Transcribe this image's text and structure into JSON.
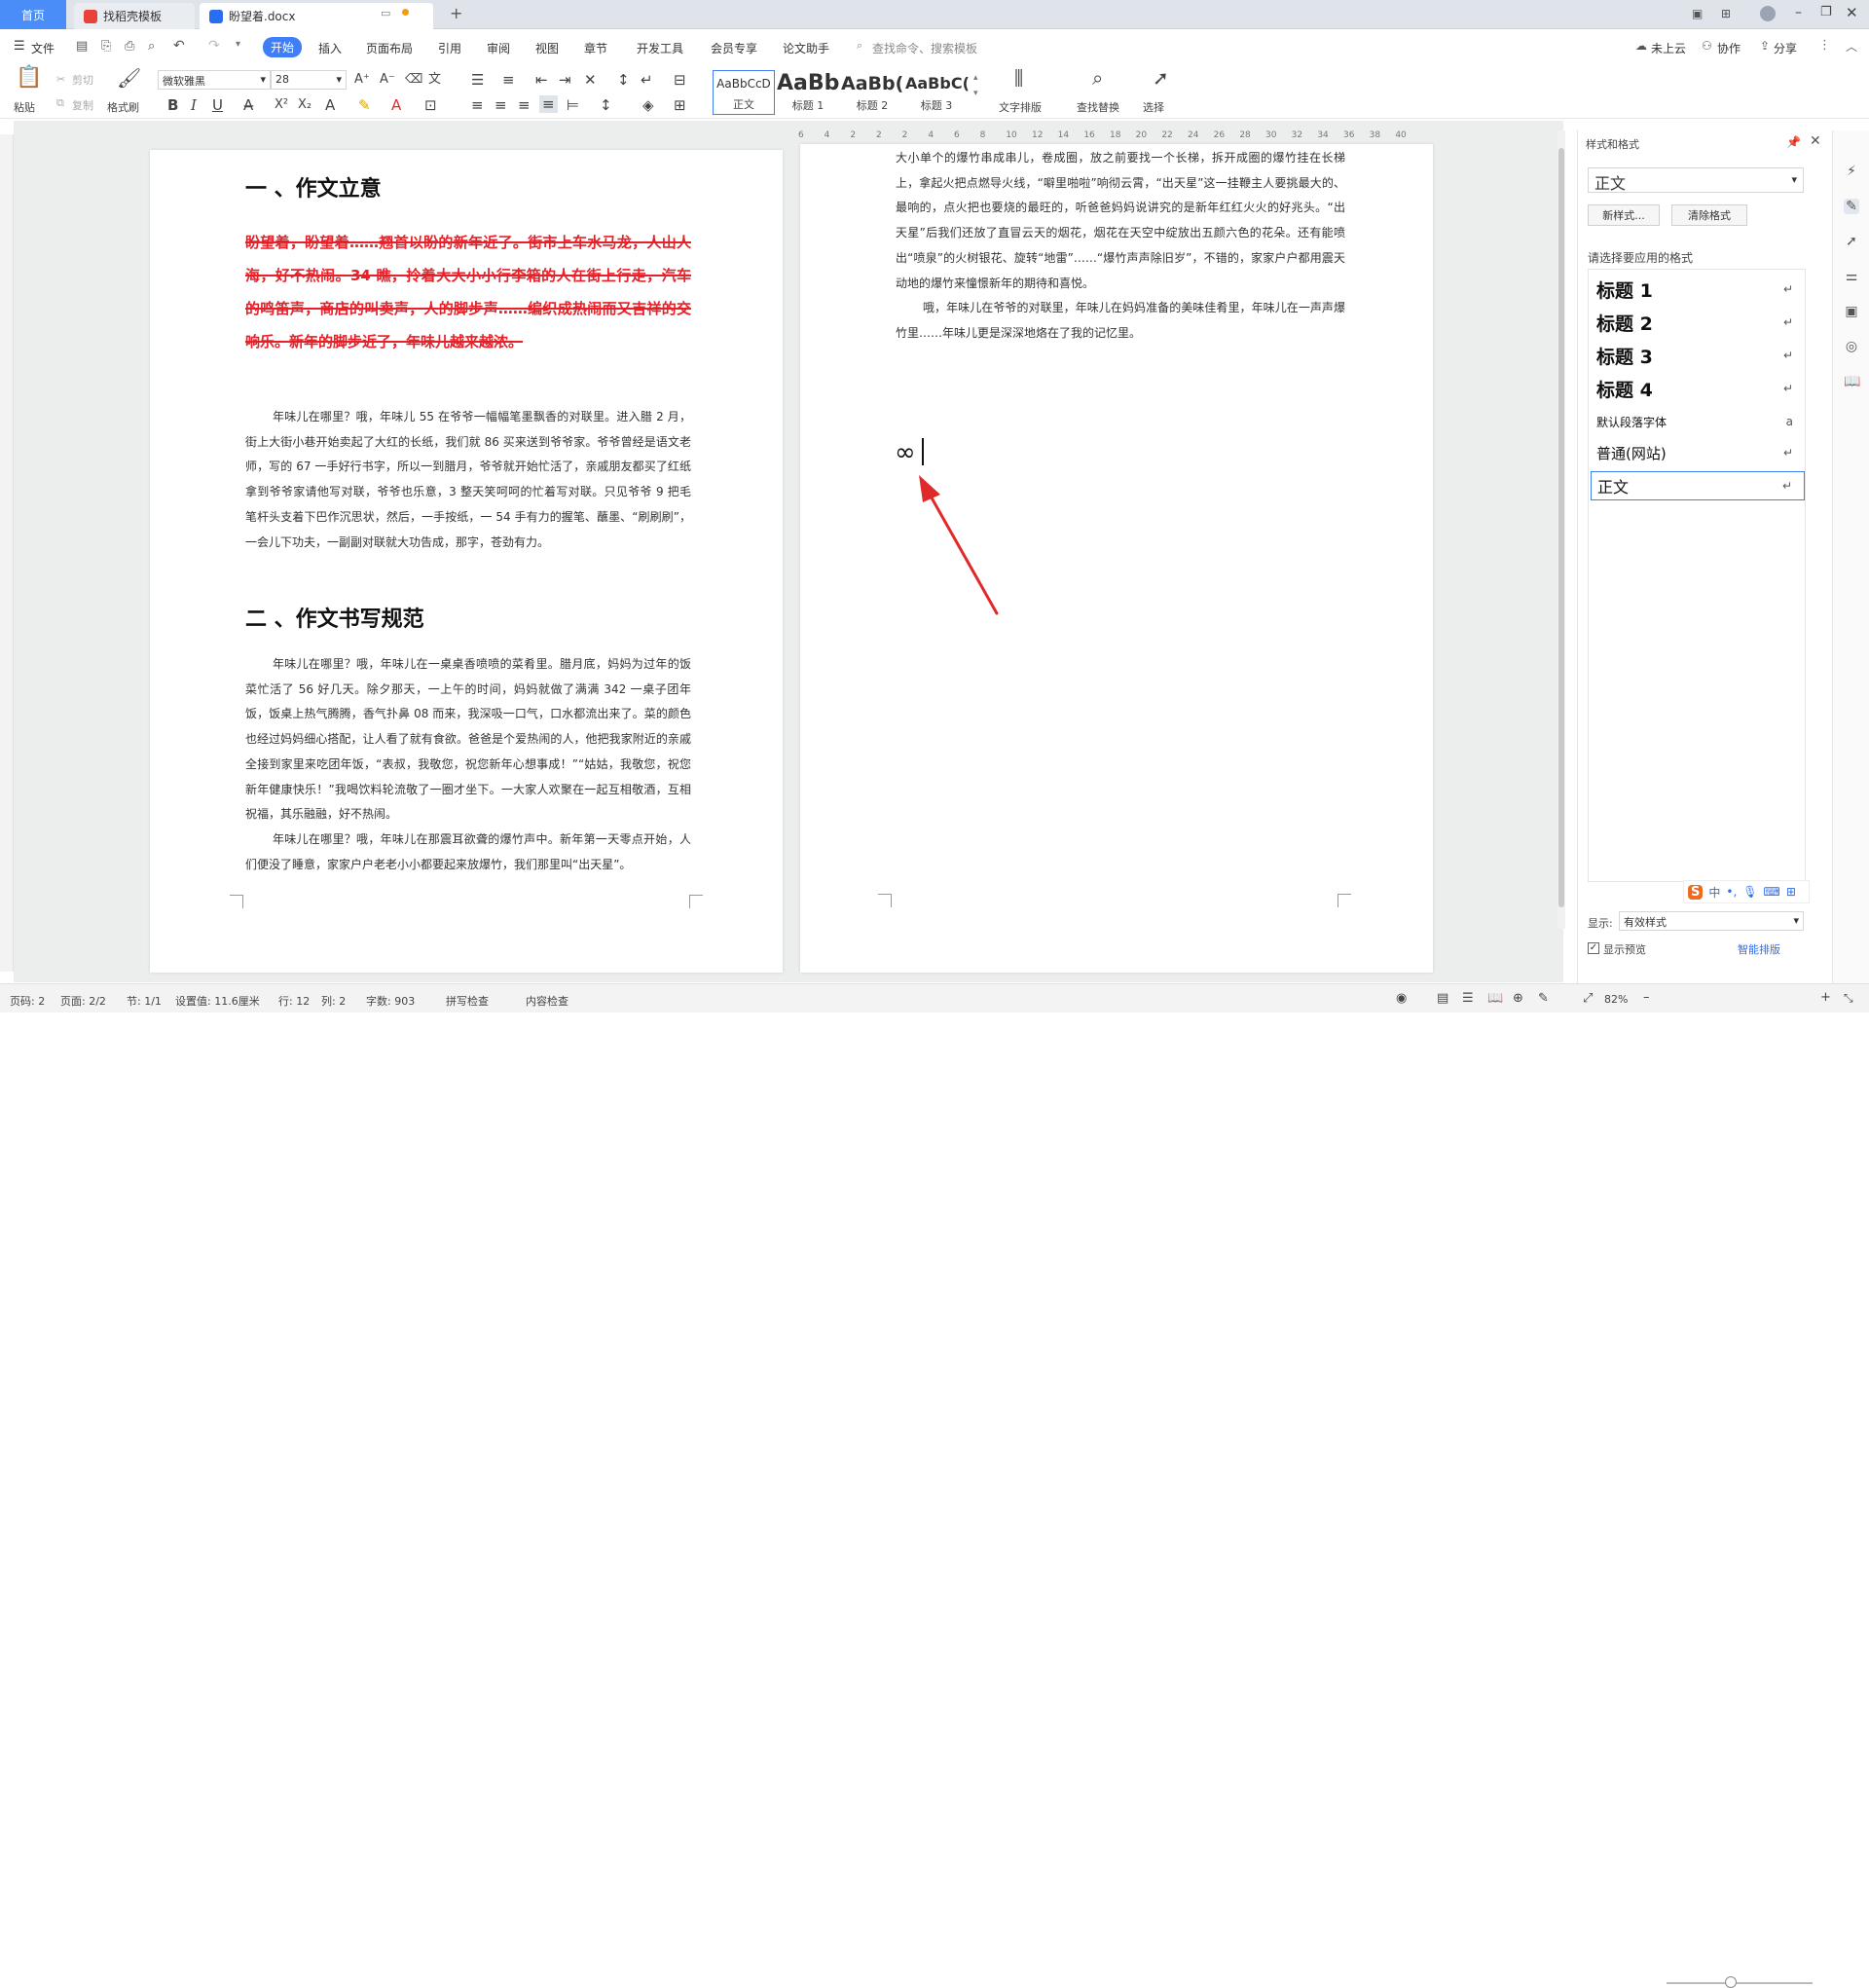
{
  "tabs": {
    "home": "首页",
    "t1": "找稻壳模板",
    "t2": "盼望着.docx"
  },
  "menu": {
    "file": "文件",
    "start": "开始",
    "insert": "插入",
    "layout": "页面布局",
    "ref": "引用",
    "review": "审阅",
    "view": "视图",
    "chapter": "章节",
    "dev": "开发工具",
    "member": "会员专享",
    "paper": "论文助手",
    "search": "查找命令、搜索模板",
    "cloud": "未上云",
    "collab": "协作",
    "share": "分享"
  },
  "ribbon": {
    "paste": "粘贴",
    "cut": "剪切",
    "copy": "复制",
    "fmt": "格式刷",
    "font": "微软雅黑",
    "size": "28",
    "s_normal": "正文",
    "s_h1": "标题 1",
    "s_h2": "标题 2",
    "s_h3": "标题 3",
    "s_normal_prev": "AaBbCcD",
    "s_h1_prev": "AaBb",
    "s_h2_prev": "AaBb(",
    "s_h3_prev": "AaBbC(",
    "textlayout": "文字排版",
    "findrep": "查找替换",
    "select": "选择"
  },
  "ruler": [
    "6",
    "4",
    "2",
    "2",
    "2",
    "4",
    "6",
    "8",
    "10",
    "12",
    "14",
    "16",
    "18",
    "20",
    "22",
    "24",
    "26",
    "28",
    "30",
    "32",
    "34",
    "36",
    "38",
    "40"
  ],
  "page1": {
    "h1": "一 、作文立意",
    "strike": "盼望着，盼望着……翘首以盼的新年近了。街市上车水马龙，人山人海，好不热闹。34 瞧，拎着大大小小行李箱的人在街上行走，汽车的鸣笛声，商店的叫卖声，人的脚步声……编织成热闹而又吉祥的交响乐。新年的脚步近了，年味儿越来越浓。",
    "p1": "年味儿在哪里？哦，年味儿 55 在爷爷一幅幅笔墨飘香的对联里。进入腊 2 月，街上大街小巷开始卖起了大红的长纸，我们就 86 买来送到爷爷家。爷爷曾经是语文老师，写的 67 一手好行书字，所以一到腊月，爷爷就开始忙活了，亲戚朋友都买了红纸拿到爷爷家请他写对联，爷爷也乐意，3 整天笑呵呵的忙着写对联。只见爷爷 9 把毛笔杆头支着下巴作沉思状，然后，一手按纸，一 54 手有力的握笔、蘸墨、“刷刷刷”，一会儿下功夫，一副副对联就大功告成，那字，苍劲有力。",
    "h2": "二 、作文书写规范",
    "p2": "年味儿在哪里？哦，年味儿在一桌桌香喷喷的菜肴里。腊月底，妈妈为过年的饭菜忙活了 56 好几天。除夕那天，一上午的时间，妈妈就做了满满 342 一桌子团年饭，饭桌上热气腾腾，香气扑鼻 08 而来，我深吸一口气，口水都流出来了。菜的颜色也经过妈妈细心搭配，让人看了就有食欲。爸爸是个爱热闹的人，他把我家附近的亲戚全接到家里来吃团年饭，“表叔，我敬您，祝您新年心想事成！”“姑姑，我敬您，祝您新年健康快乐！”我喝饮料轮流敬了一圈才坐下。一大家人欢聚在一起互相敬酒，互相祝福，其乐融融，好不热闹。",
    "p3": "年味儿在哪里？哦，年味儿在那震耳欲聋的爆竹声中。新年第一天零点开始，人们便没了睡意，家家户户老老小小都要起来放爆竹，我们那里叫“出天星”。"
  },
  "page2": {
    "p1": "大小单个的爆竹串成串儿，卷成圈，放之前要找一个长梯，拆开成圈的爆竹挂在长梯上，拿起火把点燃导火线，“噼里啪啦”响彻云霄，“出天星”这一挂鞭主人要挑最大的、最响的，点火把也要烧的最旺的，听爸爸妈妈说讲究的是新年红红火火的好兆头。“出天星”后我们还放了直冒云天的烟花，烟花在天空中绽放出五颜六色的花朵。还有能喷出“喷泉”的火树银花、旋转“地雷”……“爆竹声声除旧岁”，不错的，家家户户都用震天动地的爆竹来憧憬新年的期待和喜悦。",
    "p2": "哦，年味儿在爷爷的对联里，年味儿在妈妈准备的美味佳肴里，年味儿在一声声爆竹里……年味儿更是深深地烙在了我的记忆里。",
    "symbol": "∞"
  },
  "pane": {
    "title": "样式和格式",
    "current": "正文",
    "newstyle": "新样式...",
    "clear": "清除格式",
    "applylabel": "请选择要应用的格式",
    "items": [
      "标题  1",
      "标题  2",
      "标题  3",
      "标题  4",
      "默认段落字体",
      "普通(网站)",
      "正文"
    ],
    "showlabel": "显示:",
    "show": "有效样式",
    "preview": "显示预览",
    "smart": "智能排版"
  },
  "status": {
    "page": "页码: 2",
    "pages": "页面: 2/2",
    "sec": "节: 1/1",
    "setting": "设置值: 11.6厘米",
    "row": "行: 12",
    "col": "列: 2",
    "words": "字数: 903",
    "spell": "拼写检查",
    "content": "内容检查",
    "zoom": "82%"
  },
  "colors": {
    "accent": "#3f7ef6",
    "strike": "#e5222a",
    "arrow": "#e02a2a"
  }
}
